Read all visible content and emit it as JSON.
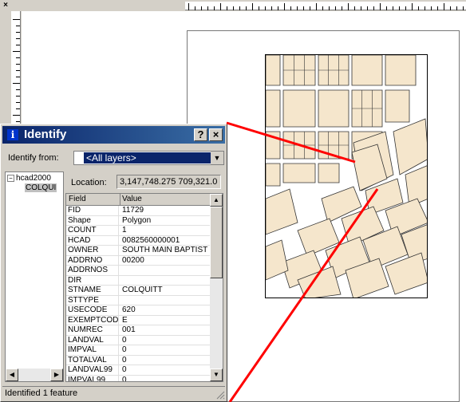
{
  "app": {
    "close_glyph": "×"
  },
  "dialog": {
    "title": "Identify",
    "help_label": "?",
    "close_label": "×",
    "identify_from_label": "Identify from:",
    "identify_from_value": "<All layers>",
    "tree": {
      "parent": "hcad2000",
      "child": "COLQUI"
    },
    "location_label": "Location:",
    "location_value": "3,147,748.275  709,321.0",
    "columns": {
      "field": "Field",
      "value": "Value"
    },
    "rows": [
      {
        "field": "FID",
        "value": "11729"
      },
      {
        "field": "Shape",
        "value": "Polygon"
      },
      {
        "field": "COUNT",
        "value": "1"
      },
      {
        "field": "HCAD",
        "value": "0082560000001"
      },
      {
        "field": "OWNER",
        "value": "SOUTH MAIN BAPTIST"
      },
      {
        "field": "ADDRNO",
        "value": "00200"
      },
      {
        "field": "ADDRNOS",
        "value": ""
      },
      {
        "field": "DIR",
        "value": ""
      },
      {
        "field": "STNAME",
        "value": "COLQUITT"
      },
      {
        "field": "STTYPE",
        "value": ""
      },
      {
        "field": "USECODE",
        "value": "620"
      },
      {
        "field": "EXEMPTCODE",
        "value": "E"
      },
      {
        "field": "NUMREC",
        "value": "001"
      },
      {
        "field": "LANDVAL",
        "value": "0"
      },
      {
        "field": "IMPVAL",
        "value": "0"
      },
      {
        "field": "TOTALVAL",
        "value": "0"
      },
      {
        "field": "LANDVAL99",
        "value": "0"
      },
      {
        "field": "IMPVAL99",
        "value": "0"
      }
    ],
    "status": "Identified 1 feature"
  },
  "colors": {
    "parcel_fill": "#f5e6cc",
    "highlight_line": "#ff0000",
    "title_bar": "#0a246a"
  },
  "icons": {
    "title": "info-icon",
    "tree_toggle": "minus-icon",
    "combo_arrow": "chevron-down-icon"
  }
}
